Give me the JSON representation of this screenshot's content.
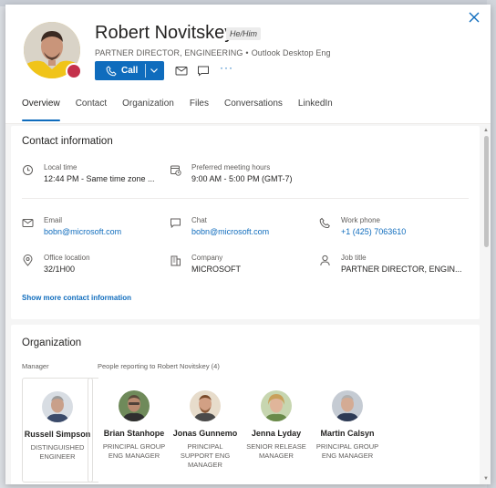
{
  "profile": {
    "name": "Robert Novitskey",
    "pronouns": "He/Him",
    "title": "PARTNER DIRECTOR, ENGINEERING",
    "separator": "•",
    "department": "Outlook Desktop Eng",
    "presence_color": "#c4314b"
  },
  "actions": {
    "call_label": "Call",
    "more_label": "···"
  },
  "tabs": [
    {
      "label": "Overview",
      "active": true
    },
    {
      "label": "Contact",
      "active": false
    },
    {
      "label": "Organization",
      "active": false
    },
    {
      "label": "Files",
      "active": false
    },
    {
      "label": "Conversations",
      "active": false
    },
    {
      "label": "LinkedIn",
      "active": false
    }
  ],
  "contact": {
    "title": "Contact information",
    "local_time": {
      "label": "Local time",
      "value": "12:44 PM - Same time zone ..."
    },
    "meeting_hours": {
      "label": "Preferred meeting hours",
      "value": "9:00 AM - 5:00 PM (GMT-7)"
    },
    "email": {
      "label": "Email",
      "value": "bobn@microsoft.com"
    },
    "chat": {
      "label": "Chat",
      "value": "bobn@microsoft.com"
    },
    "work_phone": {
      "label": "Work phone",
      "value": "+1 (425) 7063610"
    },
    "office": {
      "label": "Office location",
      "value": "32/1H00"
    },
    "company": {
      "label": "Company",
      "value": "MICROSOFT"
    },
    "job_title": {
      "label": "Job title",
      "value": "PARTNER DIRECTOR, ENGIN..."
    },
    "show_more": "Show more contact information"
  },
  "organization": {
    "title": "Organization",
    "manager_label": "Manager",
    "reports_label": "People reporting to Robert Novitskey (4)",
    "manager": {
      "name": "Russell Simpson",
      "role": "DISTINGUISHED ENGINEER"
    },
    "reports": [
      {
        "name": "Brian Stanhope",
        "role": "PRINCIPAL GROUP ENG MANAGER"
      },
      {
        "name": "Jonas Gunnemo",
        "role": "PRINCIPAL SUPPORT ENG MANAGER"
      },
      {
        "name": "Jenna Lyday",
        "role": "SENIOR RELEASE MANAGER"
      },
      {
        "name": "Martin Calsyn",
        "role": "PRINCIPAL GROUP ENG MANAGER"
      }
    ]
  },
  "colors": {
    "accent": "#0f6cbd"
  }
}
